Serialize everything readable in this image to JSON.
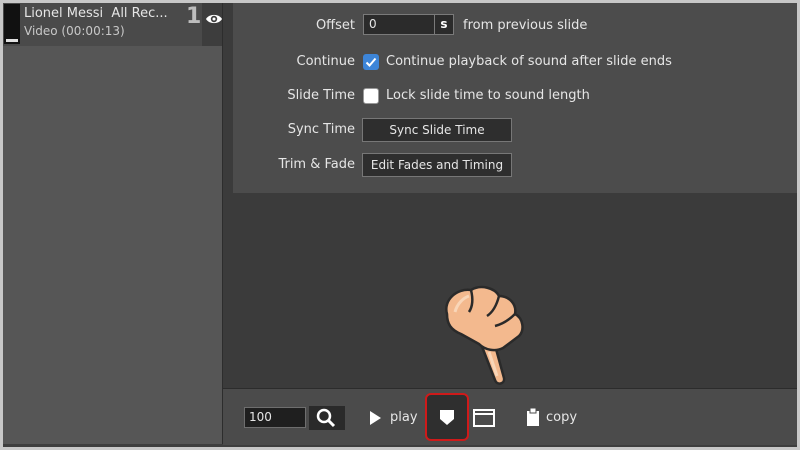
{
  "media_list": {
    "items": [
      {
        "title": "Lionel Messi  All Rec...",
        "subtitle": "Video (00:00:13)",
        "number": "1",
        "icon": "eye-icon"
      }
    ]
  },
  "properties": {
    "offset": {
      "label": "Offset",
      "value": "0",
      "unit": "s",
      "suffix": "from previous slide"
    },
    "continue": {
      "label": "Continue",
      "checked": true,
      "text": "Continue playback of sound after slide ends"
    },
    "slide_time": {
      "label": "Slide Time",
      "checked": false,
      "text": "Lock slide time to sound length"
    },
    "sync_time": {
      "label": "Sync Time",
      "button": "Sync Slide Time"
    },
    "trim_fade": {
      "label": "Trim & Fade",
      "button": "Edit Fades and Timing"
    }
  },
  "toolbar": {
    "zoom_value": "100",
    "play_label": "play",
    "copy_label": "copy",
    "icons": [
      "search-icon",
      "play-icon",
      "marker-icon",
      "window-icon",
      "clipboard-icon"
    ],
    "highlight_color": "#cf1a1a"
  },
  "colors": {
    "accent": "#3d85d8",
    "panel": "#4c4c4c",
    "background": "#3b3b3b"
  }
}
